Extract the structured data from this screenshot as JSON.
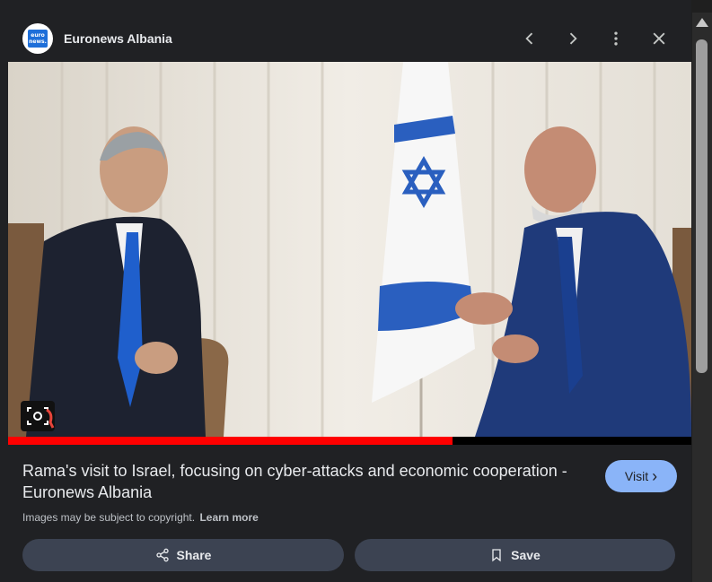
{
  "source": {
    "name": "Euronews Albania",
    "logo_text": "euro news."
  },
  "header_actions": {
    "previous": "chevron-left-icon",
    "next": "chevron-right-icon",
    "more": "more-vert-icon",
    "close": "close-icon"
  },
  "media": {
    "progress_percent": 65
  },
  "caption": {
    "title": "Rama's visit to Israel, focusing on cyber-attacks and economic cooperation - Euronews Albania",
    "copyright": "Images may be subject to copyright.",
    "learn_more": "Learn more"
  },
  "visit": {
    "label": "Visit",
    "chevron": "›"
  },
  "actions": {
    "share": "Share",
    "save": "Save"
  },
  "colors": {
    "accent": "#8ab4f8",
    "progress": "#ff0000",
    "button_bg": "#3c4352",
    "panel_bg": "#202124"
  }
}
